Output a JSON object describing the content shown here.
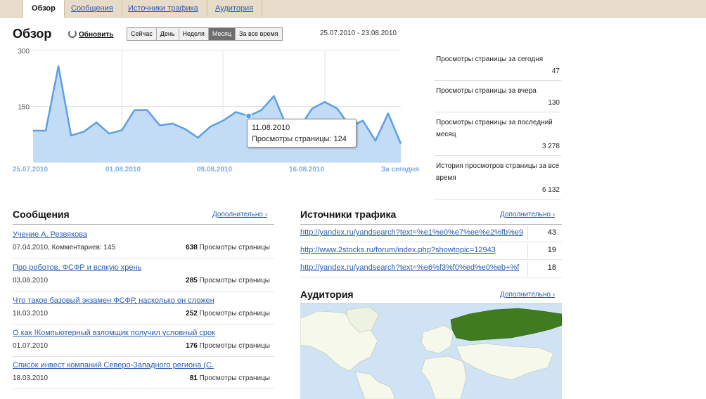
{
  "tabs": [
    {
      "label": "Обзор"
    },
    {
      "label": "Сообщения"
    },
    {
      "label": "Источники трафика"
    },
    {
      "label": "Аудитория"
    }
  ],
  "header": {
    "title": "Обзор",
    "refresh_label": "Обновить",
    "periods": [
      "Сейчас",
      "День",
      "Неделя",
      "Месяц",
      "За все время"
    ],
    "selected_period": "Месяц",
    "date_range": "25.07.2010 - 23.08.2010"
  },
  "chart_data": {
    "type": "area",
    "x_labels": [
      "25.07.2010",
      "01.08.2010",
      "09.08.2010",
      "16.08.2010",
      "За сегодня"
    ],
    "y_ticks": [
      150,
      300
    ],
    "ylim": [
      0,
      300
    ],
    "values": [
      85,
      85,
      258,
      72,
      82,
      107,
      77,
      86,
      140,
      140,
      99,
      104,
      89,
      66,
      96,
      112,
      135,
      124,
      140,
      178,
      95,
      92,
      144,
      162,
      144,
      95,
      112,
      58,
      131,
      50
    ],
    "color": "#5b9fe4",
    "fill": "#c3dcf6",
    "highlight_index": 17,
    "tooltip": {
      "date": "11.08.2010",
      "text": "Просмотры страницы: 124"
    }
  },
  "stats": [
    {
      "label": "Просмотры страницы за сегодня",
      "value": "47"
    },
    {
      "label": "Просмотры страницы за вчера",
      "value": "130"
    },
    {
      "label": "Просмотры страницы за последний месяц",
      "value": "3 278"
    },
    {
      "label": "История просмотров страницы за все время",
      "value": "6 132"
    }
  ],
  "messages": {
    "title": "Сообщения",
    "more_label": "Дополнительно ›",
    "items": [
      {
        "title": "Учение А. Резвякова",
        "meta": "07.04.2010, Комментариев: 145",
        "views": "638",
        "views_label": "Просмотры страницы"
      },
      {
        "title": "Про роботов, ФСФР и всякую хрень",
        "meta": "03.08.2010",
        "views": "285",
        "views_label": "Просмотры страницы"
      },
      {
        "title": "Что такое базовый экзамен ФСФР, насколько он сложен",
        "meta": "18.03.2010",
        "views": "252",
        "views_label": "Просмотры страницы"
      },
      {
        "title": "О как !Компьютерный взломщик получил условный срок",
        "meta": "01.07.2010",
        "views": "176",
        "views_label": "Просмотры страницы"
      },
      {
        "title": "Список инвест компаний Северо-Западного региона (С.",
        "meta": "18.03.2010",
        "views": "81",
        "views_label": "Просмотры страницы"
      }
    ]
  },
  "traffic": {
    "title": "Источники трафика",
    "more_label": "Дополнительно ›",
    "items": [
      {
        "url": "http://yandex.ru/yandsearch?text=%e1%e0%e7%ee%e2%fb%e9",
        "count": "43"
      },
      {
        "url": "http://www.2stocks.ru/forum/index.php?showtopic=12943",
        "count": "19"
      },
      {
        "url": "http://yandex.ru/yandsearch?text=%e6%f3%f0%ed%e0%eb+%f",
        "count": "18"
      }
    ]
  },
  "audience": {
    "title": "Аудитория",
    "more_label": "Дополнительно ›",
    "ocean_color": "#cfe3f5",
    "land_color": "#f6f8ec",
    "highlight_color": "#3f7b1f"
  }
}
